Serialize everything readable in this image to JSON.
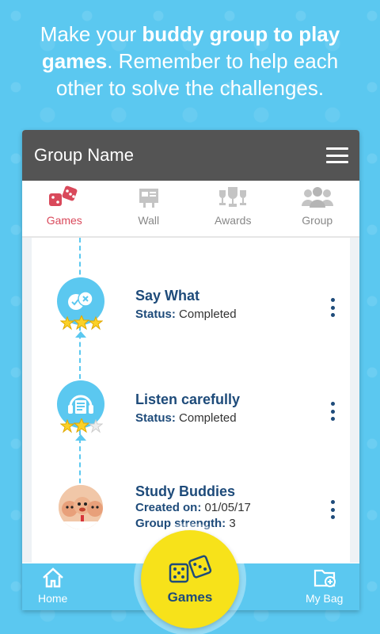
{
  "headline": {
    "part1": "Make your ",
    "bold": "buddy group to play games",
    "part2": ". Remember to help each other to solve the challenges."
  },
  "topbar": {
    "title": "Group Name",
    "menu_icon": "hamburger-menu-icon"
  },
  "tabs": [
    {
      "label": "Games",
      "icon": "dice-icon",
      "active": true
    },
    {
      "label": "Wall",
      "icon": "wall-board-icon",
      "active": false
    },
    {
      "label": "Awards",
      "icon": "trophies-icon",
      "active": false
    },
    {
      "label": "Group",
      "icon": "people-icon",
      "active": false
    }
  ],
  "items": [
    {
      "name": "Say What",
      "status_label": "Status:",
      "status_value": "Completed",
      "icon": "chat-bubbles-icon",
      "stars_filled": 3,
      "stars_total": 3
    },
    {
      "name": "Listen carefully",
      "status_label": "Status:",
      "status_value": "Completed",
      "icon": "headphones-icon",
      "stars_filled": 2,
      "stars_total": 3
    },
    {
      "name": "Study Buddies",
      "created_label": "Created on:",
      "created_value": "01/05/17",
      "strength_label": "Group strength:",
      "strength_value": "3",
      "icon": "group-photo"
    }
  ],
  "bottom_nav": {
    "home": {
      "label": "Home",
      "icon": "home-icon"
    },
    "games": {
      "label": "Games",
      "icon": "dice-icon"
    },
    "bag": {
      "label": "My Bag",
      "icon": "folder-add-icon"
    }
  },
  "colors": {
    "accent": "#5bc8f0",
    "active_tab": "#d9495b",
    "fab": "#f7e21a",
    "text_dark": "#1e4b7a",
    "topbar": "#545454"
  }
}
